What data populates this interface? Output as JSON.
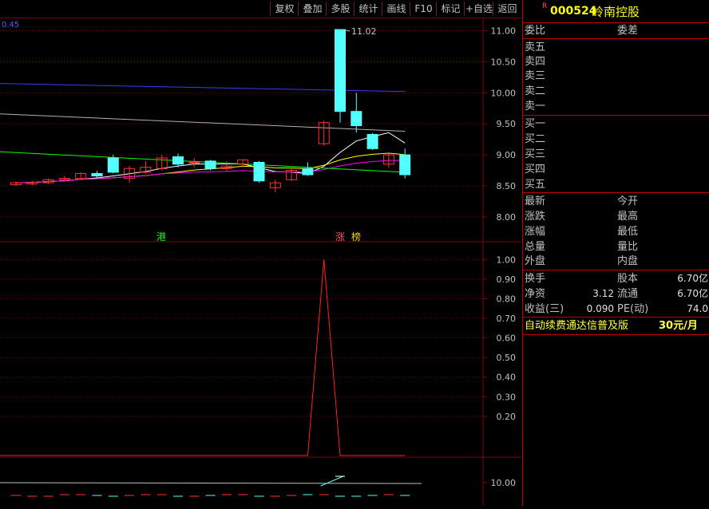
{
  "toolbar": {
    "buttons": [
      "复权",
      "叠加",
      "多股",
      "统计",
      "画线",
      "F10",
      "标记",
      "+自选",
      "返回"
    ]
  },
  "chart": {
    "corner_value": "0.45",
    "price_ticks": [
      "11.00",
      "10.50",
      "10.00",
      "9.50",
      "9.00",
      "8.50",
      "8.00"
    ],
    "peak_label": "11.02",
    "marker_gang": "港",
    "marker_zhang": "涨",
    "marker_bang": "榜",
    "indicator_ticks": [
      "1.00",
      "0.90",
      "0.80",
      "0.70",
      "0.60",
      "0.50",
      "0.40",
      "0.30",
      "0.20"
    ],
    "volume_tick": "10.00",
    "colors": {
      "up": "#ff3232",
      "down": "#54ffff",
      "grid": "#800000",
      "ma5": "#ffffff",
      "ma10": "#ffff00",
      "ma20": "#ff00ff",
      "ma60": "#00ff00",
      "blue": "#3030ff"
    }
  },
  "chart_data": {
    "type": "candlestick",
    "ylim": [
      7.6,
      11.2
    ],
    "candles": [
      {
        "o": 8.52,
        "c": 8.55,
        "h": 8.57,
        "l": 8.5
      },
      {
        "o": 8.53,
        "c": 8.56,
        "h": 8.58,
        "l": 8.51
      },
      {
        "o": 8.55,
        "c": 8.6,
        "h": 8.62,
        "l": 8.53
      },
      {
        "o": 8.6,
        "c": 8.62,
        "h": 8.66,
        "l": 8.58
      },
      {
        "o": 8.62,
        "c": 8.7,
        "h": 8.72,
        "l": 8.6
      },
      {
        "o": 8.7,
        "c": 8.66,
        "h": 8.74,
        "l": 8.62
      },
      {
        "o": 8.95,
        "c": 8.72,
        "h": 9.0,
        "l": 8.7
      },
      {
        "o": 8.62,
        "c": 8.78,
        "h": 8.82,
        "l": 8.55
      },
      {
        "o": 8.72,
        "c": 8.8,
        "h": 8.9,
        "l": 8.7
      },
      {
        "o": 8.78,
        "c": 8.95,
        "h": 9.0,
        "l": 8.75
      },
      {
        "o": 8.97,
        "c": 8.85,
        "h": 9.02,
        "l": 8.8
      },
      {
        "o": 8.88,
        "c": 8.88,
        "h": 8.95,
        "l": 8.8
      },
      {
        "o": 8.9,
        "c": 8.78,
        "h": 8.92,
        "l": 8.75
      },
      {
        "o": 8.78,
        "c": 8.82,
        "h": 8.9,
        "l": 8.74
      },
      {
        "o": 8.85,
        "c": 8.92,
        "h": 8.93,
        "l": 8.8
      },
      {
        "o": 8.88,
        "c": 8.58,
        "h": 8.9,
        "l": 8.55
      },
      {
        "o": 8.47,
        "c": 8.55,
        "h": 8.6,
        "l": 8.4
      },
      {
        "o": 8.6,
        "c": 8.75,
        "h": 8.8,
        "l": 8.58
      },
      {
        "o": 8.78,
        "c": 8.68,
        "h": 8.88,
        "l": 8.66
      },
      {
        "o": 9.18,
        "c": 9.52,
        "h": 9.55,
        "l": 9.15
      },
      {
        "o": 11.02,
        "c": 9.7,
        "h": 11.02,
        "l": 9.52
      },
      {
        "o": 9.7,
        "c": 9.47,
        "h": 10.0,
        "l": 9.36
      },
      {
        "o": 9.33,
        "c": 9.1,
        "h": 9.35,
        "l": 9.08
      },
      {
        "o": 8.85,
        "c": 9.0,
        "h": 9.02,
        "l": 8.8
      },
      {
        "o": 9.0,
        "c": 8.68,
        "h": 9.1,
        "l": 8.62
      }
    ],
    "indicator_ylim": [
      0,
      1.05
    ],
    "indicator_values": [
      0,
      0,
      0,
      0,
      0,
      0,
      0,
      0,
      0,
      0,
      0,
      0,
      0,
      0,
      0,
      0,
      0,
      0,
      0,
      1.0,
      0,
      0,
      0,
      0,
      0
    ]
  },
  "stock": {
    "marker": "R",
    "code": "000524",
    "name": "岭南控股"
  },
  "panel": {
    "weibi": "委比",
    "weicha": "委差",
    "asks": [
      "卖五",
      "卖四",
      "卖三",
      "卖二",
      "卖一"
    ],
    "bids": [
      "买一",
      "买二",
      "买三",
      "买四",
      "买五"
    ],
    "quote_left": [
      "最新",
      "涨跌",
      "涨幅",
      "总量",
      "外盘"
    ],
    "quote_right": [
      "今开",
      "最高",
      "最低",
      "量比",
      "内盘"
    ],
    "turnover": "换手",
    "share_capital": "股本",
    "share_capital_val": "6.70亿",
    "net_assets": "净资",
    "net_assets_val": "3.12",
    "float_label": "流通",
    "float_val": "6.70亿",
    "eps_label": "收益(三)",
    "eps_val": "0.090",
    "pe_label": "PE(动)",
    "pe_val": "74.0",
    "ad_text": "自动续费通达信普及版",
    "ad_price": "30元/月"
  }
}
